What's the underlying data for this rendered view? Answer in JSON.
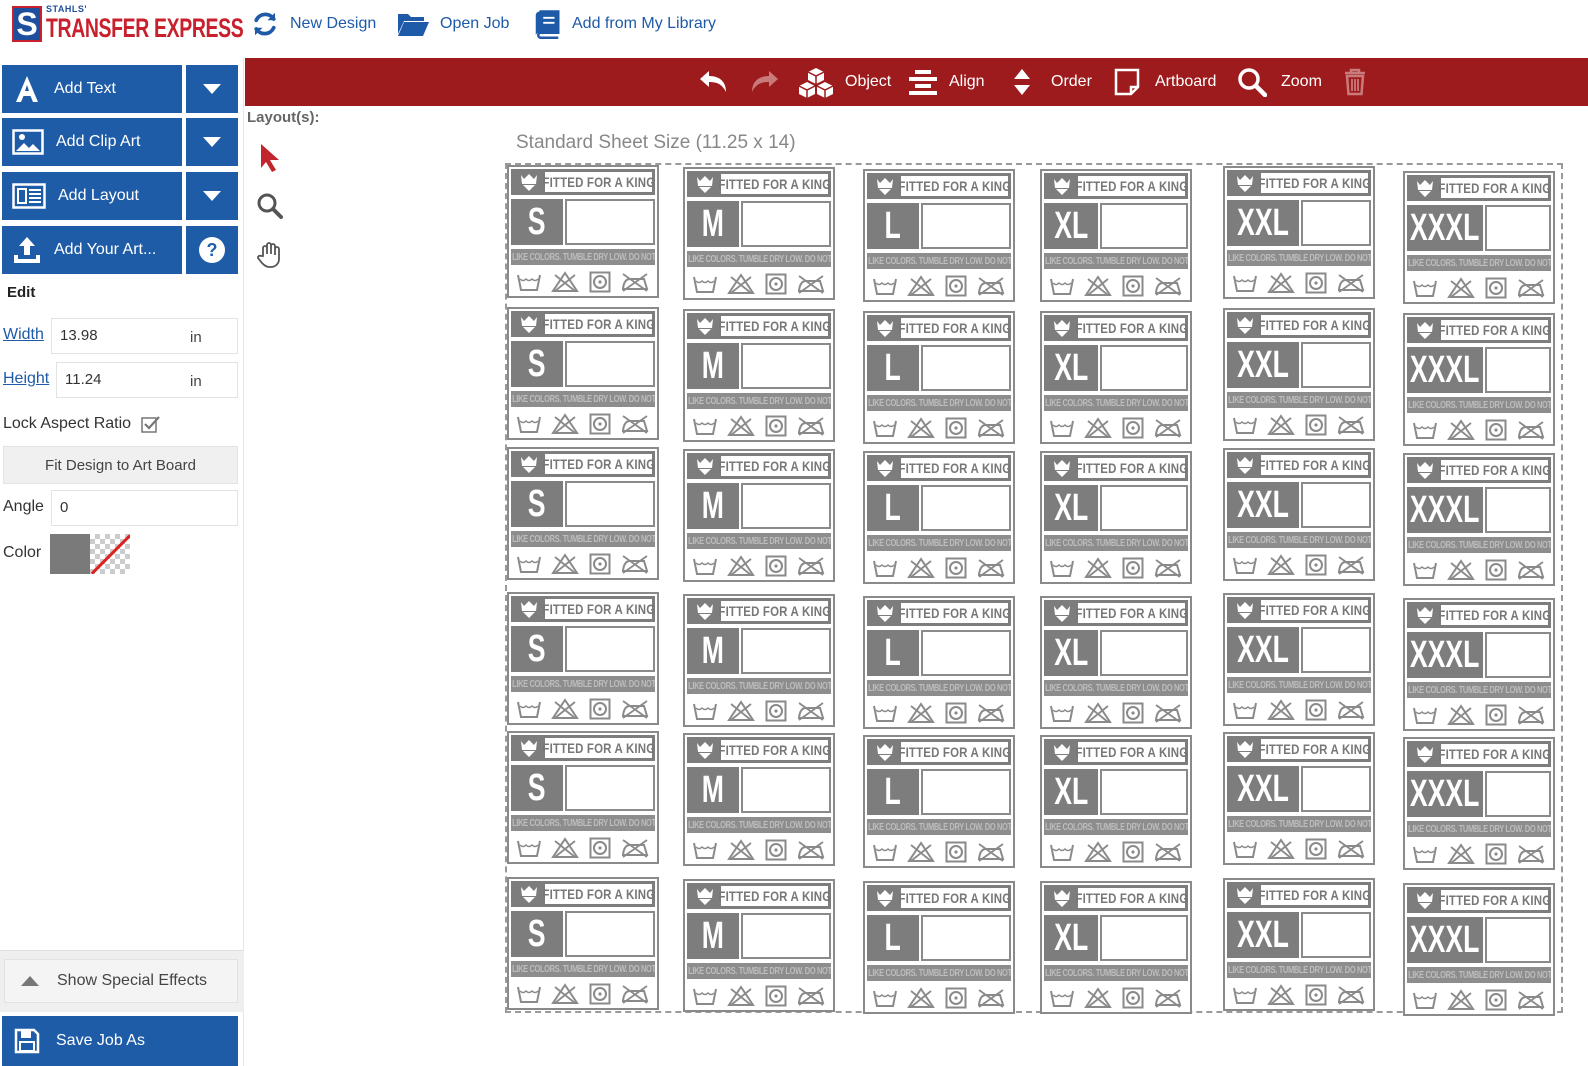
{
  "header": {
    "logo": {
      "small": "STAHLS'",
      "letter": "S",
      "brand": "TRANSFER EXPRESS"
    },
    "buttons": [
      {
        "label": "New Design",
        "icon": "refresh-icon"
      },
      {
        "label": "Open Job",
        "icon": "folder-open-icon"
      },
      {
        "label": "Add from My Library",
        "icon": "book-icon"
      }
    ]
  },
  "left_panel": {
    "tools": [
      {
        "label": "Add Text",
        "icon": "text-icon"
      },
      {
        "label": "Add Clip Art",
        "icon": "image-icon"
      },
      {
        "label": "Add Layout",
        "icon": "layout-icon"
      },
      {
        "label": "Add Your Art...",
        "icon": "upload-icon"
      }
    ],
    "edit_title": "Edit",
    "width": {
      "label": "Width",
      "value": "13.98",
      "unit": "in"
    },
    "height": {
      "label": "Height",
      "value": "11.24",
      "unit": "in"
    },
    "lock_aspect_label": "Lock Aspect Ratio",
    "lock_aspect_checked": true,
    "fit_button": "Fit Design to Art Board",
    "angle": {
      "label": "Angle",
      "value": "0"
    },
    "color": {
      "label": "Color",
      "swatch": "#7a7a7a"
    },
    "special_effects": "Show Special Effects",
    "save_button": "Save Job As"
  },
  "toolbar": {
    "object": "Object",
    "align": "Align",
    "order": "Order",
    "artboard": "Artboard",
    "zoom": "Zoom"
  },
  "canvas": {
    "layouts_label": "Layout(s):",
    "sheet_title": "Standard Sheet Size (11.25 x 14)",
    "label_text": "FITTED FOR A KING",
    "fine_print": "WASH INSIDE OUT WITH LIKE COLORS. TUMBLE DRY LOW. DO NOT IRON ON DECORATION.",
    "sizes": [
      "S",
      "M",
      "L",
      "XL",
      "XXL",
      "XXXL"
    ],
    "rows": 6
  },
  "colors": {
    "brand_blue": "#1f5ca8",
    "toolbar_red": "#9d1b1d",
    "label_gray": "#7d7d7d"
  }
}
